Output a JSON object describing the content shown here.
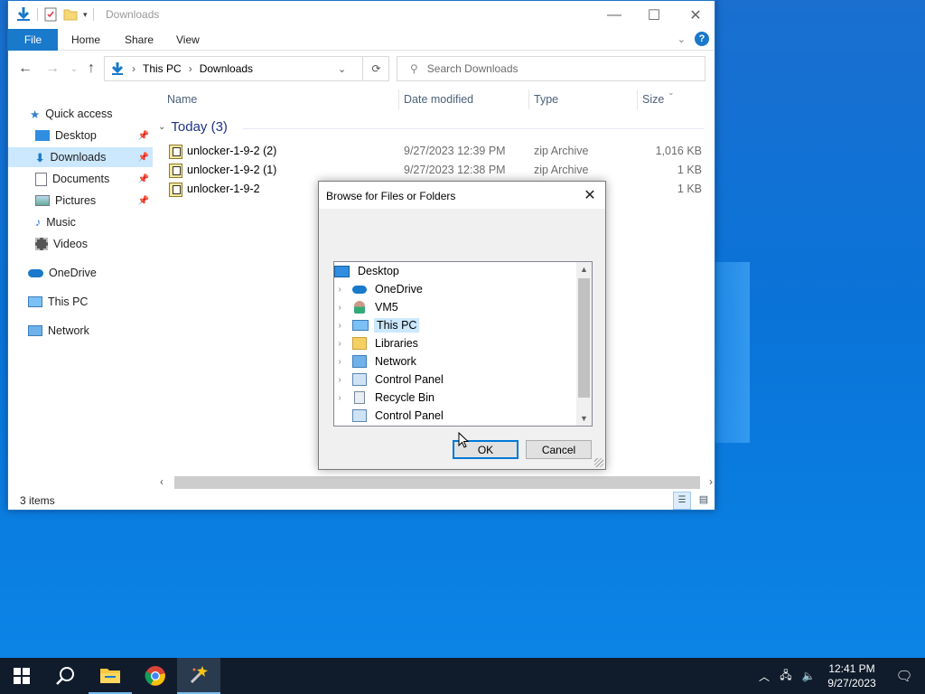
{
  "explorer": {
    "title": "Downloads",
    "ribbon_tabs": [
      "File",
      "Home",
      "Share",
      "View"
    ],
    "address": {
      "segments": [
        "This PC",
        "Downloads"
      ]
    },
    "search": {
      "placeholder": "Search Downloads"
    },
    "sidebar": {
      "items": [
        {
          "label": "Quick access",
          "icon": "star-icon"
        },
        {
          "label": "Desktop",
          "icon": "desktop-folder-icon",
          "pinned": true
        },
        {
          "label": "Downloads",
          "icon": "downloads-folder-icon",
          "pinned": true,
          "selected": true
        },
        {
          "label": "Documents",
          "icon": "documents-folder-icon",
          "pinned": true
        },
        {
          "label": "Pictures",
          "icon": "pictures-folder-icon",
          "pinned": true
        },
        {
          "label": "Music",
          "icon": "music-folder-icon"
        },
        {
          "label": "Videos",
          "icon": "videos-folder-icon"
        },
        {
          "label": "OneDrive",
          "icon": "onedrive-icon"
        },
        {
          "label": "This PC",
          "icon": "computer-icon"
        },
        {
          "label": "Network",
          "icon": "network-icon"
        }
      ]
    },
    "columns": {
      "name": "Name",
      "date": "Date modified",
      "type": "Type",
      "size": "Size"
    },
    "group": {
      "label": "Today (3)"
    },
    "files": [
      {
        "name": "unlocker-1-9-2 (2)",
        "date": "9/27/2023 12:39 PM",
        "type": "zip Archive",
        "size": "1,016 KB"
      },
      {
        "name": "unlocker-1-9-2 (1)",
        "date": "9/27/2023 12:38 PM",
        "type": "zip Archive",
        "size": "1 KB"
      },
      {
        "name": "unlocker-1-9-2",
        "date": "",
        "type": "",
        "size": "1 KB"
      }
    ],
    "status": {
      "item_count": "3 items"
    }
  },
  "dialog": {
    "title": "Browse for Files or Folders",
    "tree": [
      {
        "label": "Desktop",
        "icon": "desktop-icon",
        "expandable": false,
        "selected": false
      },
      {
        "label": "OneDrive",
        "icon": "onedrive-icon",
        "expandable": true,
        "selected": false
      },
      {
        "label": "VM5",
        "icon": "user-icon",
        "expandable": true,
        "selected": false
      },
      {
        "label": "This PC",
        "icon": "computer-icon",
        "expandable": true,
        "selected": true
      },
      {
        "label": "Libraries",
        "icon": "libraries-icon",
        "expandable": true,
        "selected": false
      },
      {
        "label": "Network",
        "icon": "network-icon",
        "expandable": true,
        "selected": false
      },
      {
        "label": "Control Panel",
        "icon": "control-panel-icon",
        "expandable": true,
        "selected": false
      },
      {
        "label": "Recycle Bin",
        "icon": "recycle-bin-icon",
        "expandable": true,
        "selected": false
      },
      {
        "label": "Control Panel",
        "icon": "control-panel-icon",
        "expandable": false,
        "selected": false
      }
    ],
    "ok_label": "OK",
    "cancel_label": "Cancel"
  },
  "taskbar": {
    "apps": [
      "start-icon",
      "search-icon",
      "file-explorer-icon",
      "chrome-icon",
      "unlocker-app-icon"
    ],
    "clock": {
      "time": "12:41 PM",
      "date": "9/27/2023"
    }
  }
}
